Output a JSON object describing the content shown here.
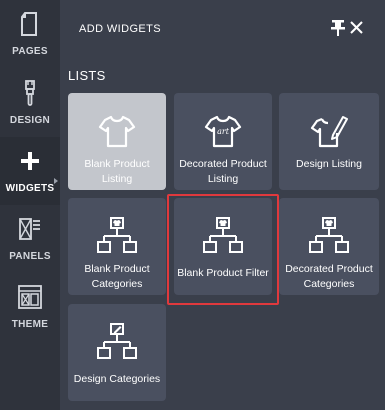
{
  "sidebar": {
    "items": [
      {
        "label": "PAGES",
        "icon": "page-icon"
      },
      {
        "label": "DESIGN",
        "icon": "brush-icon"
      },
      {
        "label": "WIDGETS",
        "icon": "plus-icon"
      },
      {
        "label": "PANELS",
        "icon": "panels-icon"
      },
      {
        "label": "THEME",
        "icon": "theme-icon"
      }
    ],
    "active": "WIDGETS"
  },
  "panel": {
    "title": "ADD WIDGETS",
    "section_title": "LISTS",
    "widgets": [
      {
        "label": "Blank Product Listing",
        "icon": "tshirt-icon",
        "selected": true
      },
      {
        "label": "Decorated Product Listing",
        "icon": "tshirt-art-icon"
      },
      {
        "label": "Design Listing",
        "icon": "tshirt-pen-icon"
      },
      {
        "label": "Blank Product Categories",
        "icon": "category-tree-icon"
      },
      {
        "label": "Blank Product Filter",
        "icon": "category-tree-icon",
        "highlighted": true
      },
      {
        "label": "Decorated Product Categories",
        "icon": "category-tree-icon"
      },
      {
        "label": "Design Categories",
        "icon": "design-tree-icon"
      }
    ],
    "tshirt_art_text": "art"
  },
  "colors": {
    "rail_bg": "#2f333c",
    "panel_bg": "#3a3f4b",
    "tile_bg": "#4a5060",
    "tile_selected_bg": "#c3c6cc",
    "highlight": "#e0393d"
  }
}
